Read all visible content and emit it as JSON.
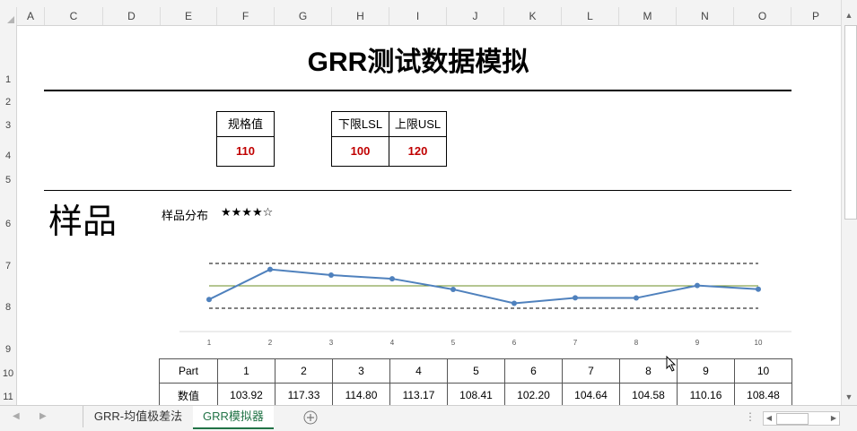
{
  "columns": [
    "A",
    "C",
    "D",
    "E",
    "F",
    "G",
    "H",
    "I",
    "J",
    "K",
    "L",
    "M",
    "N",
    "O",
    "P"
  ],
  "rows": [
    "1",
    "2",
    "3",
    "4",
    "5",
    "6",
    "7",
    "8",
    "9",
    "10",
    "11"
  ],
  "title": "GRR测试数据模拟",
  "spec": {
    "label": "规格值",
    "value": "110"
  },
  "lsl": {
    "label": "下限LSL",
    "value": "100"
  },
  "usl": {
    "label": "上限USL",
    "value": "120"
  },
  "section_title": "样品",
  "distribution_label": "样品分布",
  "distribution_rating": "★★★★☆",
  "table": {
    "row1_header": "Part",
    "row2_header": "数值",
    "parts": [
      "1",
      "2",
      "3",
      "4",
      "5",
      "6",
      "7",
      "8",
      "9",
      "10"
    ],
    "values": [
      "103.92",
      "117.33",
      "114.80",
      "113.17",
      "108.41",
      "102.20",
      "104.64",
      "104.58",
      "110.16",
      "108.48"
    ]
  },
  "chart_data": {
    "type": "line",
    "x": [
      1,
      2,
      3,
      4,
      5,
      6,
      7,
      8,
      9,
      10
    ],
    "series": [
      {
        "values": [
          103.92,
          117.33,
          114.8,
          113.17,
          108.41,
          102.2,
          104.64,
          104.58,
          110.16,
          108.48
        ]
      }
    ],
    "reference_lines": {
      "upper": 120,
      "center": 110,
      "lower": 100
    },
    "line_color": "#4f81bd",
    "center_color": "#6b8e23",
    "grid": false
  },
  "tabs": [
    "GRR-均值极差法",
    "GRR模拟器"
  ],
  "active_tab": 1
}
